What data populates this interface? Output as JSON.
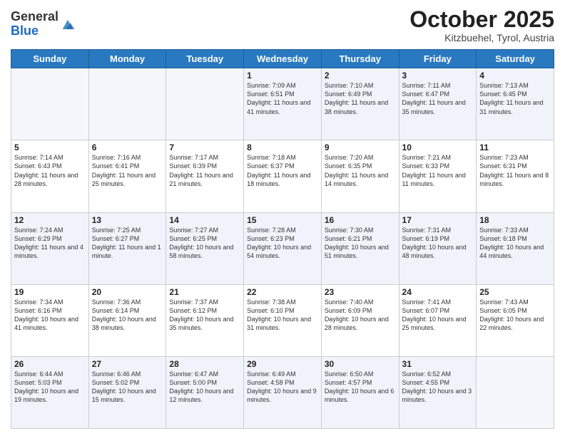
{
  "header": {
    "logo_general": "General",
    "logo_blue": "Blue",
    "month": "October 2025",
    "location": "Kitzbuehel, Tyrol, Austria"
  },
  "days_of_week": [
    "Sunday",
    "Monday",
    "Tuesday",
    "Wednesday",
    "Thursday",
    "Friday",
    "Saturday"
  ],
  "weeks": [
    [
      {
        "day": "",
        "sunrise": "",
        "sunset": "",
        "daylight": ""
      },
      {
        "day": "",
        "sunrise": "",
        "sunset": "",
        "daylight": ""
      },
      {
        "day": "",
        "sunrise": "",
        "sunset": "",
        "daylight": ""
      },
      {
        "day": "1",
        "sunrise": "Sunrise: 7:09 AM",
        "sunset": "Sunset: 6:51 PM",
        "daylight": "Daylight: 11 hours and 41 minutes."
      },
      {
        "day": "2",
        "sunrise": "Sunrise: 7:10 AM",
        "sunset": "Sunset: 6:49 PM",
        "daylight": "Daylight: 11 hours and 38 minutes."
      },
      {
        "day": "3",
        "sunrise": "Sunrise: 7:11 AM",
        "sunset": "Sunset: 6:47 PM",
        "daylight": "Daylight: 11 hours and 35 minutes."
      },
      {
        "day": "4",
        "sunrise": "Sunrise: 7:13 AM",
        "sunset": "Sunset: 6:45 PM",
        "daylight": "Daylight: 11 hours and 31 minutes."
      }
    ],
    [
      {
        "day": "5",
        "sunrise": "Sunrise: 7:14 AM",
        "sunset": "Sunset: 6:43 PM",
        "daylight": "Daylight: 11 hours and 28 minutes."
      },
      {
        "day": "6",
        "sunrise": "Sunrise: 7:16 AM",
        "sunset": "Sunset: 6:41 PM",
        "daylight": "Daylight: 11 hours and 25 minutes."
      },
      {
        "day": "7",
        "sunrise": "Sunrise: 7:17 AM",
        "sunset": "Sunset: 6:39 PM",
        "daylight": "Daylight: 11 hours and 21 minutes."
      },
      {
        "day": "8",
        "sunrise": "Sunrise: 7:18 AM",
        "sunset": "Sunset: 6:37 PM",
        "daylight": "Daylight: 11 hours and 18 minutes."
      },
      {
        "day": "9",
        "sunrise": "Sunrise: 7:20 AM",
        "sunset": "Sunset: 6:35 PM",
        "daylight": "Daylight: 11 hours and 14 minutes."
      },
      {
        "day": "10",
        "sunrise": "Sunrise: 7:21 AM",
        "sunset": "Sunset: 6:33 PM",
        "daylight": "Daylight: 11 hours and 11 minutes."
      },
      {
        "day": "11",
        "sunrise": "Sunrise: 7:23 AM",
        "sunset": "Sunset: 6:31 PM",
        "daylight": "Daylight: 11 hours and 8 minutes."
      }
    ],
    [
      {
        "day": "12",
        "sunrise": "Sunrise: 7:24 AM",
        "sunset": "Sunset: 6:29 PM",
        "daylight": "Daylight: 11 hours and 4 minutes."
      },
      {
        "day": "13",
        "sunrise": "Sunrise: 7:25 AM",
        "sunset": "Sunset: 6:27 PM",
        "daylight": "Daylight: 11 hours and 1 minute."
      },
      {
        "day": "14",
        "sunrise": "Sunrise: 7:27 AM",
        "sunset": "Sunset: 6:25 PM",
        "daylight": "Daylight: 10 hours and 58 minutes."
      },
      {
        "day": "15",
        "sunrise": "Sunrise: 7:28 AM",
        "sunset": "Sunset: 6:23 PM",
        "daylight": "Daylight: 10 hours and 54 minutes."
      },
      {
        "day": "16",
        "sunrise": "Sunrise: 7:30 AM",
        "sunset": "Sunset: 6:21 PM",
        "daylight": "Daylight: 10 hours and 51 minutes."
      },
      {
        "day": "17",
        "sunrise": "Sunrise: 7:31 AM",
        "sunset": "Sunset: 6:19 PM",
        "daylight": "Daylight: 10 hours and 48 minutes."
      },
      {
        "day": "18",
        "sunrise": "Sunrise: 7:33 AM",
        "sunset": "Sunset: 6:18 PM",
        "daylight": "Daylight: 10 hours and 44 minutes."
      }
    ],
    [
      {
        "day": "19",
        "sunrise": "Sunrise: 7:34 AM",
        "sunset": "Sunset: 6:16 PM",
        "daylight": "Daylight: 10 hours and 41 minutes."
      },
      {
        "day": "20",
        "sunrise": "Sunrise: 7:36 AM",
        "sunset": "Sunset: 6:14 PM",
        "daylight": "Daylight: 10 hours and 38 minutes."
      },
      {
        "day": "21",
        "sunrise": "Sunrise: 7:37 AM",
        "sunset": "Sunset: 6:12 PM",
        "daylight": "Daylight: 10 hours and 35 minutes."
      },
      {
        "day": "22",
        "sunrise": "Sunrise: 7:38 AM",
        "sunset": "Sunset: 6:10 PM",
        "daylight": "Daylight: 10 hours and 31 minutes."
      },
      {
        "day": "23",
        "sunrise": "Sunrise: 7:40 AM",
        "sunset": "Sunset: 6:09 PM",
        "daylight": "Daylight: 10 hours and 28 minutes."
      },
      {
        "day": "24",
        "sunrise": "Sunrise: 7:41 AM",
        "sunset": "Sunset: 6:07 PM",
        "daylight": "Daylight: 10 hours and 25 minutes."
      },
      {
        "day": "25",
        "sunrise": "Sunrise: 7:43 AM",
        "sunset": "Sunset: 6:05 PM",
        "daylight": "Daylight: 10 hours and 22 minutes."
      }
    ],
    [
      {
        "day": "26",
        "sunrise": "Sunrise: 6:44 AM",
        "sunset": "Sunset: 5:03 PM",
        "daylight": "Daylight: 10 hours and 19 minutes."
      },
      {
        "day": "27",
        "sunrise": "Sunrise: 6:46 AM",
        "sunset": "Sunset: 5:02 PM",
        "daylight": "Daylight: 10 hours and 15 minutes."
      },
      {
        "day": "28",
        "sunrise": "Sunrise: 6:47 AM",
        "sunset": "Sunset: 5:00 PM",
        "daylight": "Daylight: 10 hours and 12 minutes."
      },
      {
        "day": "29",
        "sunrise": "Sunrise: 6:49 AM",
        "sunset": "Sunset: 4:58 PM",
        "daylight": "Daylight: 10 hours and 9 minutes."
      },
      {
        "day": "30",
        "sunrise": "Sunrise: 6:50 AM",
        "sunset": "Sunset: 4:57 PM",
        "daylight": "Daylight: 10 hours and 6 minutes."
      },
      {
        "day": "31",
        "sunrise": "Sunrise: 6:52 AM",
        "sunset": "Sunset: 4:55 PM",
        "daylight": "Daylight: 10 hours and 3 minutes."
      },
      {
        "day": "",
        "sunrise": "",
        "sunset": "",
        "daylight": ""
      }
    ]
  ]
}
